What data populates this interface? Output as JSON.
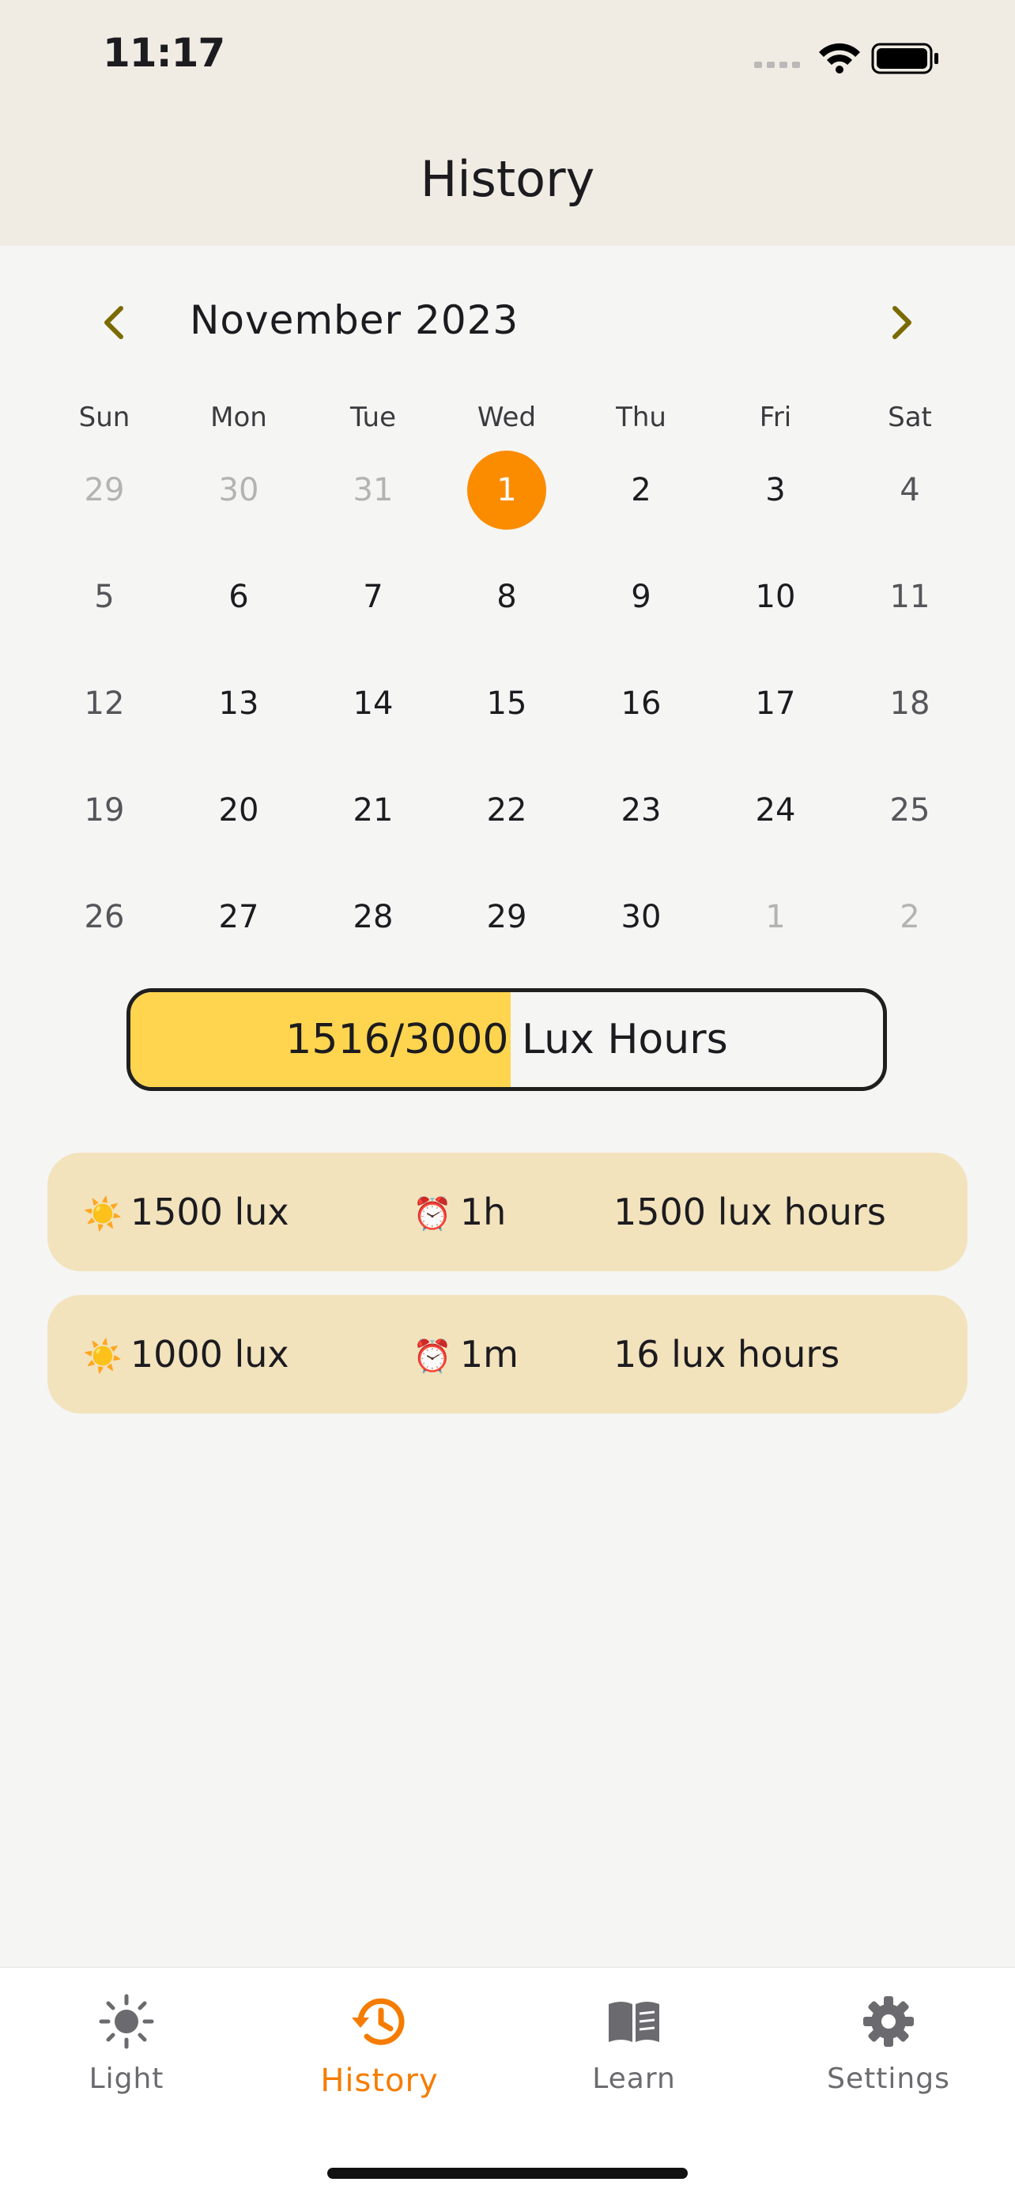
{
  "status_bar": {
    "time": "11:17"
  },
  "header": {
    "title": "History"
  },
  "calendar": {
    "month_label": "November 2023",
    "weekdays": [
      "Sun",
      "Mon",
      "Tue",
      "Wed",
      "Thu",
      "Fri",
      "Sat"
    ],
    "weeks": [
      [
        "29",
        "30",
        "31",
        "1",
        "2",
        "3",
        "4"
      ],
      [
        "5",
        "6",
        "7",
        "8",
        "9",
        "10",
        "11"
      ],
      [
        "12",
        "13",
        "14",
        "15",
        "16",
        "17",
        "18"
      ],
      [
        "19",
        "20",
        "21",
        "22",
        "23",
        "24",
        "25"
      ],
      [
        "26",
        "27",
        "28",
        "29",
        "30",
        "1",
        "2"
      ]
    ],
    "selected_day": "1"
  },
  "progress": {
    "label": "1516/3000 Lux Hours",
    "current": 1516,
    "goal": 3000,
    "fill_color": "#ffd54f"
  },
  "sessions": [
    {
      "sun_icon": "sun-emoji",
      "lux": "1500 lux",
      "clock_icon": "alarm-clock-emoji",
      "duration": "1h",
      "lux_hours": "1500 lux hours"
    },
    {
      "sun_icon": "sun-emoji",
      "lux": "1000 lux",
      "clock_icon": "alarm-clock-emoji",
      "duration": "1m",
      "lux_hours": "16 lux hours"
    }
  ],
  "bottom_nav": {
    "items": [
      {
        "label": "Light",
        "icon": "sun-icon"
      },
      {
        "label": "History",
        "icon": "history-icon",
        "active": true
      },
      {
        "label": "Learn",
        "icon": "book-icon"
      },
      {
        "label": "Settings",
        "icon": "gear-icon"
      }
    ]
  },
  "colors": {
    "accent": "#f57c00",
    "selected_day": "#fb8c00",
    "card": "#f2e3bd",
    "arrow": "#7a6a00"
  }
}
